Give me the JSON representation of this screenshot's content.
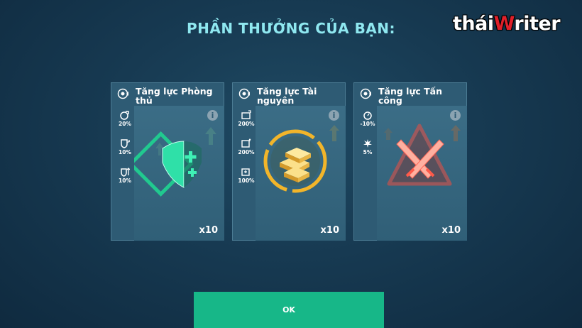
{
  "title": "PHẦN THƯỞNG CỦA BẠN:",
  "brand": {
    "part1": "thái",
    "part2": "W",
    "part3": "riter"
  },
  "cards": [
    {
      "name": "Tăng lực Phòng thủ",
      "quantity": "x10",
      "stats": [
        {
          "icon": "defense-boost-icon",
          "value": "20%"
        },
        {
          "icon": "shield-up-icon",
          "value": "10%"
        },
        {
          "icon": "shield-arrow-icon",
          "value": "10%"
        }
      ],
      "accent": "#2fd8a0"
    },
    {
      "name": "Tăng lực Tài nguyên",
      "quantity": "x10",
      "stats": [
        {
          "icon": "resource-storage-icon",
          "value": "200%"
        },
        {
          "icon": "resource-gather-icon",
          "value": "200%"
        },
        {
          "icon": "resource-production-icon",
          "value": "100%"
        }
      ],
      "accent": "#f2c040"
    },
    {
      "name": "Tăng lực Tấn công",
      "quantity": "x10",
      "stats": [
        {
          "icon": "timer-icon",
          "value": "-10%"
        },
        {
          "icon": "attack-burst-icon",
          "value": "5%"
        }
      ],
      "accent": "#ff5a4a"
    }
  ],
  "ok_label": "OK",
  "info_glyph": "i"
}
